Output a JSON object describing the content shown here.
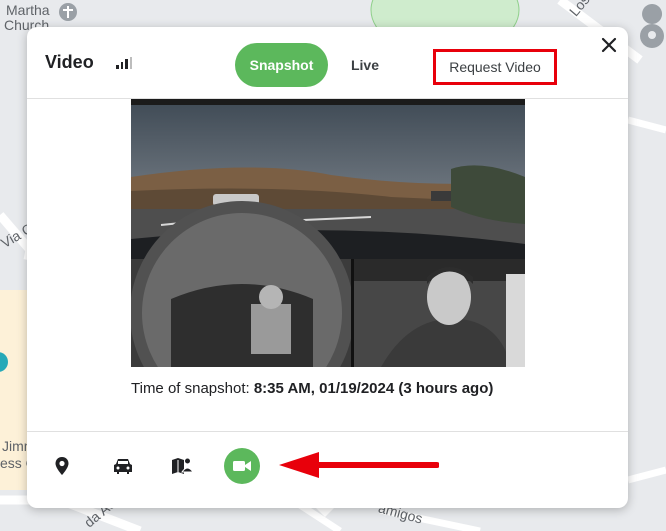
{
  "map": {
    "labels": {
      "church_line1": "Martha",
      "church_line2": "Church",
      "via": "Via C",
      "jimm": "Jimm",
      "ess": "ess C",
      "amigos": "amigos",
      "da_ac": "da Ac",
      "los": "Los"
    }
  },
  "popup": {
    "title": "Video",
    "tabs": {
      "snapshot_label": "Snapshot",
      "live_label": "Live"
    },
    "request_video_label": "Request Video",
    "close_icon": "close-icon",
    "snapshot_caption": {
      "prefix": "Time of snapshot: ",
      "value": "8:35 AM, 01/19/2024 (3 hours ago)"
    },
    "toolbar": {
      "items": [
        {
          "icon": "location-pin-icon"
        },
        {
          "icon": "car-icon"
        },
        {
          "icon": "driver-route-icon"
        },
        {
          "icon": "video-camera-icon"
        }
      ]
    }
  },
  "colors": {
    "accent_green": "#5cb85c",
    "highlight_red": "#e8000b"
  }
}
